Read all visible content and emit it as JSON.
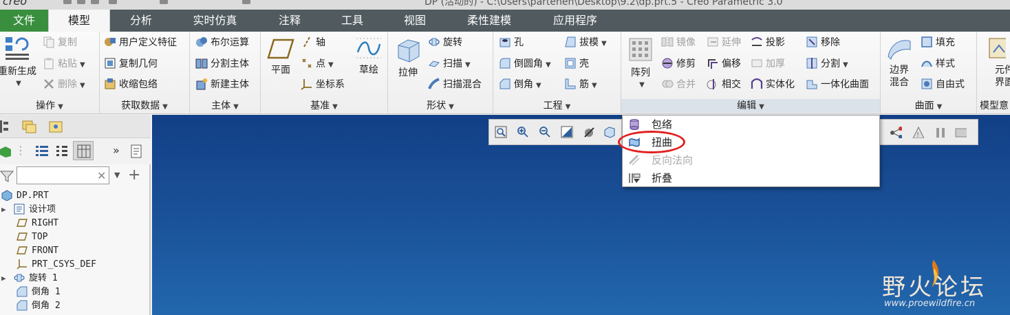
{
  "window": {
    "title": "DP (活动的) - C:\\Users\\parteneh\\Desktop\\9.2\\dp.prt.5 - Creo Parametric 3.0",
    "logo": "creo"
  },
  "tabs": [
    "文件",
    "模型",
    "分析",
    "实时仿真",
    "注释",
    "工具",
    "视图",
    "柔性建模",
    "应用程序"
  ],
  "ribbon": {
    "operations": {
      "label": "操作",
      "regenerate": "重新生成",
      "copy": "复制",
      "paste": "粘贴",
      "delete": "删除"
    },
    "get_data": {
      "label": "获取数据",
      "user_defined_feature": "用户定义特征",
      "copy_geometry": "复制几何",
      "shrinkwrap": "收缩包络"
    },
    "body": {
      "label": "主体",
      "boolean": "布尔运算",
      "split_body": "分割主体",
      "new_body": "新建主体"
    },
    "datum": {
      "label": "基准",
      "plane": "平面",
      "axis": "轴",
      "point": "点",
      "csys": "坐标系",
      "sketch": "草绘"
    },
    "shapes": {
      "label": "形状",
      "extrude": "拉伸",
      "revolve": "旋转",
      "sweep": "扫描",
      "swept_blend": "扫描混合"
    },
    "engineering": {
      "label": "工程",
      "hole": "孔",
      "round": "倒圆角",
      "chamfer": "倒角",
      "draft": "拔模",
      "shell": "壳",
      "rib": "筋"
    },
    "editing": {
      "label": "编辑",
      "pattern": "阵列",
      "mirror": "镜像",
      "trim": "修剪",
      "merge": "合并",
      "extend": "延伸",
      "offset": "偏移",
      "intersect": "相交",
      "project": "投影",
      "thicken": "加厚",
      "solidify": "实体化",
      "remove": "移除",
      "split": "分割",
      "unify": "一体化曲面"
    },
    "surfaces": {
      "label": "曲面",
      "boundary_blend_1": "边界",
      "boundary_blend_2": "混合",
      "fill": "填充",
      "style": "样式",
      "freestyle": "自由式"
    },
    "model_intent": {
      "label": "模型意",
      "element_1": "元件",
      "element_2": "界面"
    }
  },
  "edit_menu": {
    "items": [
      {
        "label": "包络",
        "enabled": true
      },
      {
        "label": "扭曲",
        "enabled": true,
        "highlighted": true
      },
      {
        "label": "反向法向",
        "enabled": false
      },
      {
        "label": "折叠",
        "enabled": true
      }
    ]
  },
  "model_tree": {
    "search": {
      "value": "",
      "placeholder": ""
    },
    "items": [
      {
        "label": "DP.PRT",
        "icon": "part-icon"
      },
      {
        "label": "设计项",
        "icon": "design-items-icon",
        "expandable": true
      },
      {
        "label": "RIGHT",
        "icon": "datum-plane-icon"
      },
      {
        "label": "TOP",
        "icon": "datum-plane-icon"
      },
      {
        "label": "FRONT",
        "icon": "datum-plane-icon"
      },
      {
        "label": "PRT_CSYS_DEF",
        "icon": "csys-icon"
      },
      {
        "label": "旋转 1",
        "icon": "revolve-icon",
        "expandable": true
      },
      {
        "label": "倒角 1",
        "icon": "chamfer-icon"
      },
      {
        "label": "倒角 2",
        "icon": "chamfer-icon"
      }
    ]
  },
  "watermark": {
    "title": "野火论坛",
    "url": "www.proewildfire.cn"
  },
  "colors": {
    "file_tab": "#3a8f3e",
    "tab_bar": "#505a5f",
    "canvas_top": "#123f86",
    "canvas_bottom": "#2267ad",
    "highlight_ring": "#e22020"
  }
}
